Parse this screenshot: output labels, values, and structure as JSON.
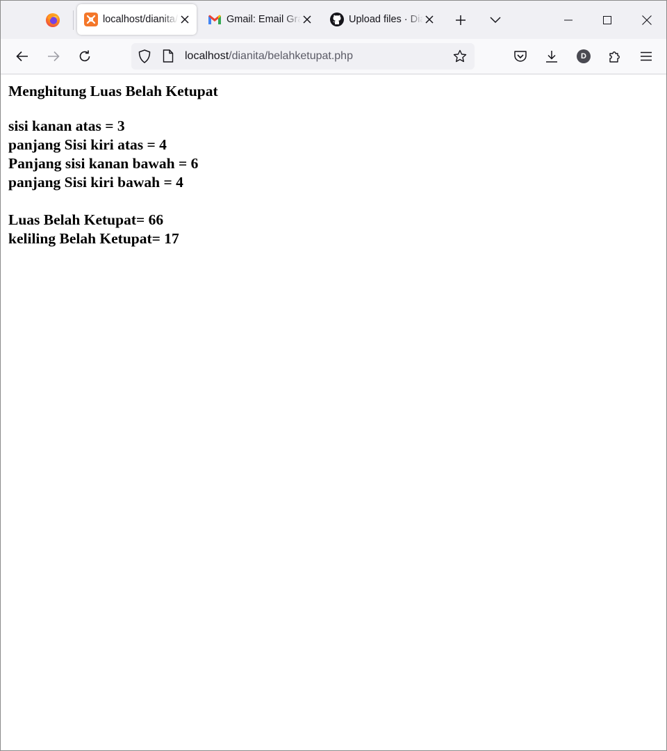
{
  "browser": {
    "tabs": [
      {
        "title": "localhost/dianita/belahketupat.php",
        "icon": "xampp-icon",
        "active": true
      },
      {
        "title": "Gmail: Email Gratis",
        "icon": "gmail-icon",
        "active": false
      },
      {
        "title": "Upload files · Dianita",
        "icon": "github-icon",
        "active": false
      }
    ],
    "url_host": "localhost",
    "url_path": "/dianita/belahketupat.php",
    "profile_initial": "D"
  },
  "page": {
    "heading": "Menghitung Luas Belah Ketupat",
    "sides": [
      "sisi kanan atas = 3",
      "panjang Sisi kiri atas = 4",
      "Panjang sisi kanan bawah = 6",
      "panjang Sisi kiri bawah = 4"
    ],
    "results": [
      "Luas Belah Ketupat= 66",
      "keliling Belah Ketupat= 17"
    ]
  }
}
